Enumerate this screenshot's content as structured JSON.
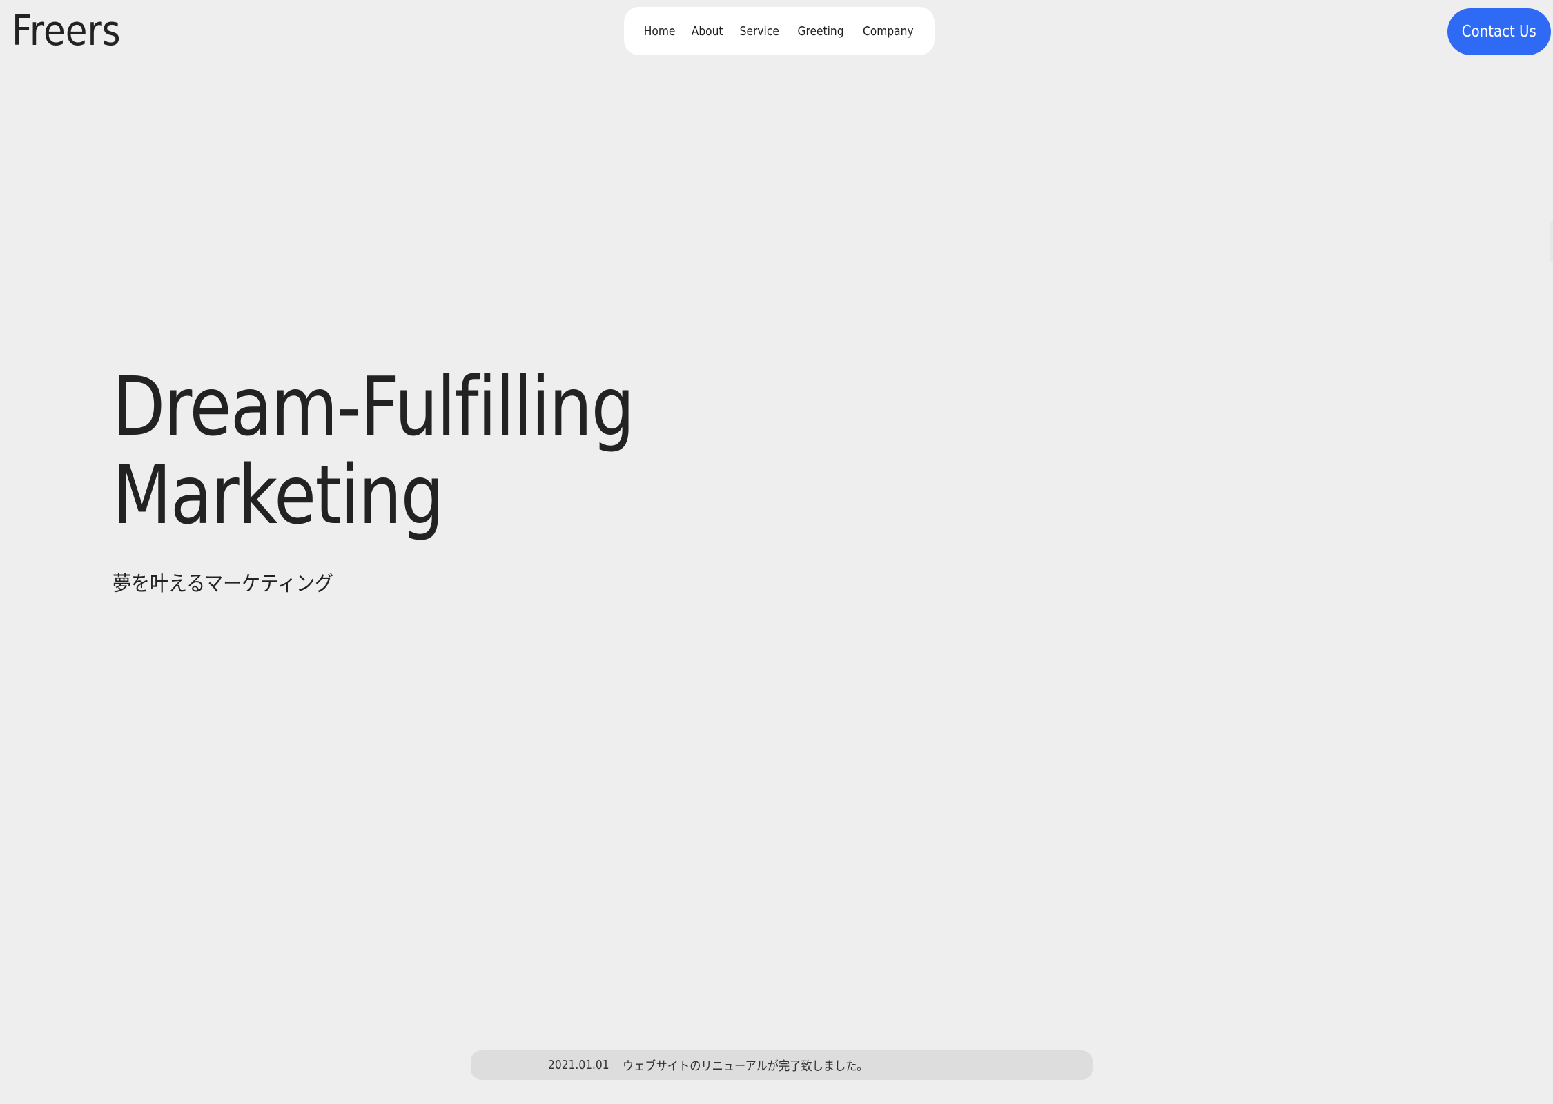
{
  "header": {
    "logo": "Freers",
    "nav": [
      {
        "label": "Home"
      },
      {
        "label": "About"
      },
      {
        "label": "Service"
      },
      {
        "label": "Greeting"
      },
      {
        "label": "Company"
      }
    ],
    "contact_label": "Contact Us"
  },
  "hero": {
    "title_line1": "Dream-Fulfilling",
    "title_line2": "Marketing",
    "subtitle": "夢を叶えるマーケティング"
  },
  "news": {
    "date": "2021.01.01",
    "text": "ウェブサイトのリニューアルが完了致しました。"
  },
  "colors": {
    "background": "#eeeeee",
    "accent": "#2f6af5",
    "nav_background": "#ffffff",
    "news_background": "#dddddd",
    "text": "#222222"
  }
}
